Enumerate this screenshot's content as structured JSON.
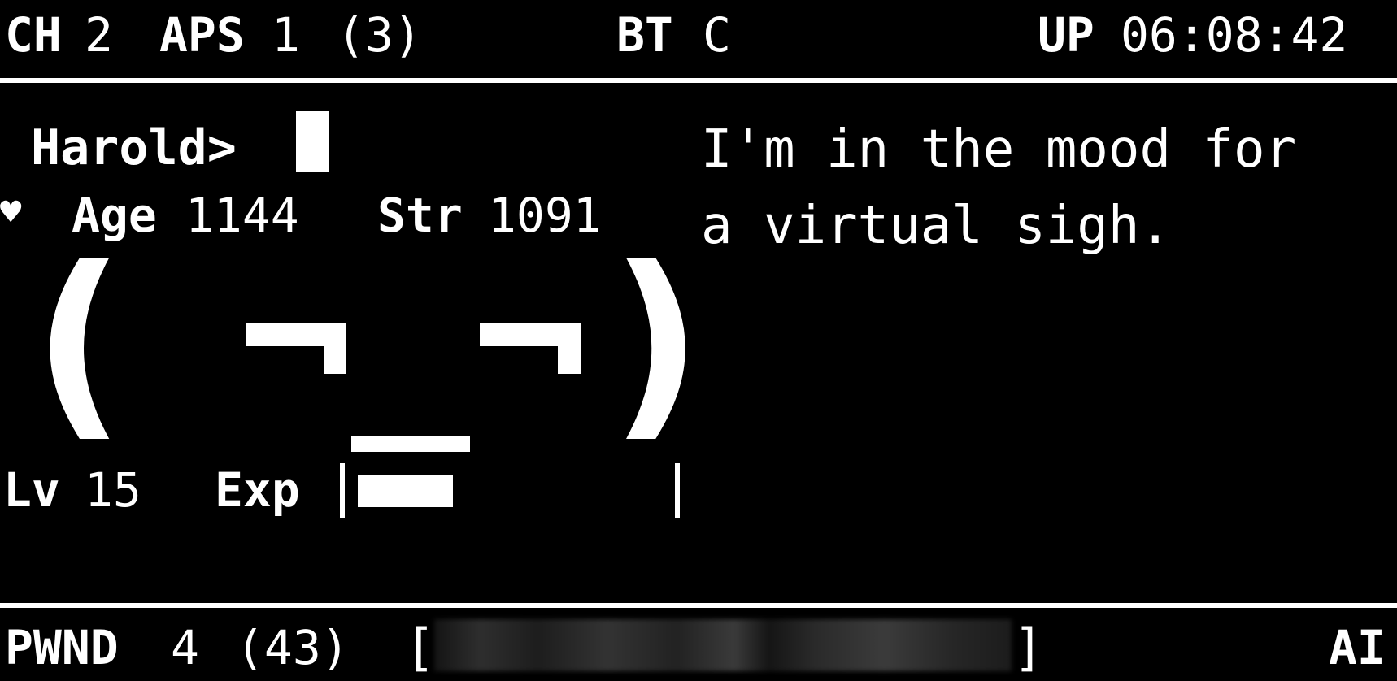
{
  "header": {
    "ch_label": "CH",
    "ch_value": "2",
    "aps_label": "APS",
    "aps_value": "1",
    "aps_total": "(3)",
    "bt_label": "BT",
    "bt_value": "C",
    "up_label": "UP",
    "up_value": "06:08:42"
  },
  "prompt": {
    "name": "Harold>"
  },
  "stats": {
    "heart_glyph": "♥",
    "age_label": "Age",
    "age_value": "1144",
    "str_label": "Str",
    "str_value": "1091"
  },
  "face": {
    "left_paren": "(",
    "right_paren": ")"
  },
  "level": {
    "lv_label": "Lv",
    "lv_value": "15",
    "exp_label": "Exp",
    "exp_fraction": 0.3
  },
  "message": {
    "line1": "I'm in the mood for",
    "line2": "a virtual sigh."
  },
  "footer": {
    "pwnd_label": "PWND",
    "pwnd_value": "4",
    "pwnd_total": "(43)",
    "bracket_open": "[",
    "bracket_close": "]",
    "mode": "AI"
  },
  "colors": {
    "background": "#000000",
    "foreground": "#ffffff"
  }
}
